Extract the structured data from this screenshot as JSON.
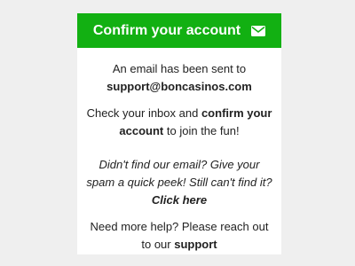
{
  "header": {
    "title": "Confirm your account",
    "icon": "envelope-icon",
    "background": "#12b012"
  },
  "message": {
    "line1": "An email has been sent to",
    "email": "support@boncasinos.com",
    "check_prefix": "Check your inbox and",
    "check_bold": "confirm your account",
    "check_suffix": "to join the fun!",
    "spam_text": "Didn't find our email? Give your spam a quick peek! Still can't find it?",
    "click_here": "Click here",
    "help_prefix": "Need more help? Please reach out to our",
    "support_link": "support"
  }
}
